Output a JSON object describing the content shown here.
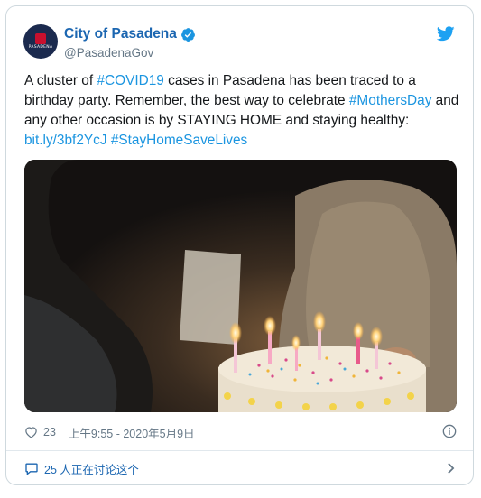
{
  "tweet": {
    "display_name": "City of Pasadena",
    "handle": "@PasadenaGov",
    "avatar_text": "PASADENA",
    "text_parts": [
      "A cluster of ",
      "#COVID19",
      " cases in Pasadena has been traced to a birthday party. Remember, the best way to celebrate ",
      "#MothersDay",
      " and any other occasion is by STAYING HOME and staying healthy: ",
      "bit.ly/3bf2YcJ",
      " ",
      "#StayHomeSaveLives"
    ],
    "likes": "23",
    "timestamp": "上午9:55 - 2020年5月9日",
    "discussion": "25 人正在讨论这个"
  },
  "icons": {
    "verified": "verified-badge-icon",
    "bird": "twitter-bird-icon",
    "heart": "heart-icon",
    "info": "info-icon",
    "bubble": "speech-bubble-icon",
    "chevron": "chevron-right-icon"
  },
  "colors": {
    "accent": "#1b95e0",
    "name": "#1b66b1",
    "muted": "#657786",
    "border": "#cfd9de"
  }
}
